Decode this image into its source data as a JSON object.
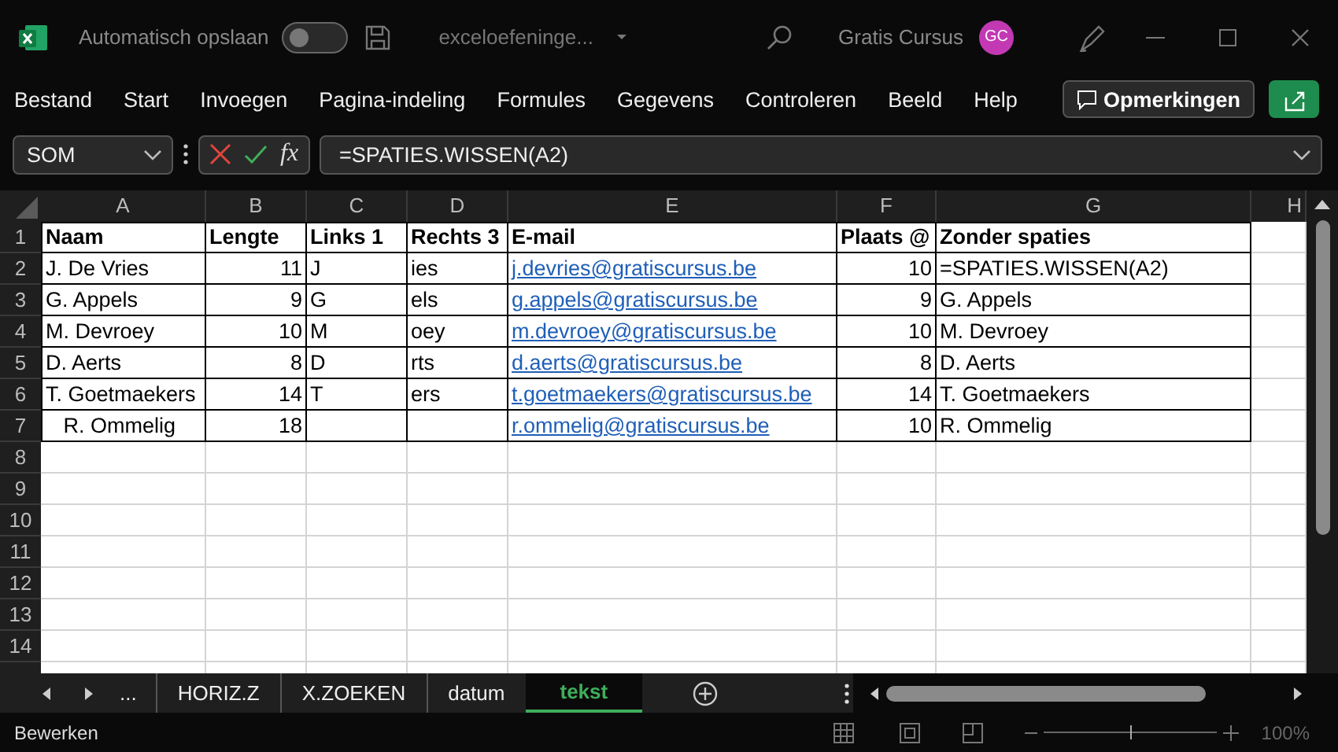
{
  "titlebar": {
    "autosave_label": "Automatisch opslaan",
    "autosave_on": false,
    "filename": "exceloefeninge...",
    "account": "Gratis Cursus",
    "avatar": "GC"
  },
  "ribbon": {
    "tabs": [
      "Bestand",
      "Start",
      "Invoegen",
      "Pagina-indeling",
      "Formules",
      "Gegevens",
      "Controleren",
      "Beeld",
      "Help"
    ],
    "comments_button": "Opmerkingen"
  },
  "formula_bar": {
    "name_box": "SOM",
    "fx": "fx",
    "formula": "=SPATIES.WISSEN(A2)"
  },
  "sheet": {
    "columns": [
      "A",
      "B",
      "C",
      "D",
      "E",
      "F",
      "G",
      "H"
    ],
    "rows": [
      {
        "number": "1",
        "cells": [
          {
            "kind": "header",
            "text": "Naam"
          },
          {
            "kind": "header",
            "text": "Lengte"
          },
          {
            "kind": "header",
            "text": "Links 1"
          },
          {
            "kind": "header",
            "text": "Rechts 3"
          },
          {
            "kind": "header",
            "text": "E-mail"
          },
          {
            "kind": "header",
            "text": "Plaats @"
          },
          {
            "kind": "header",
            "text": "Zonder spaties"
          }
        ]
      },
      {
        "number": "2",
        "cells": [
          {
            "kind": "text",
            "text": "J. De Vries"
          },
          {
            "kind": "number",
            "text": "11"
          },
          {
            "kind": "text",
            "text": "J"
          },
          {
            "kind": "text",
            "text": "ies"
          },
          {
            "kind": "link",
            "text": "j.devries@gratiscursus.be"
          },
          {
            "kind": "number",
            "text": "10"
          },
          {
            "kind": "text",
            "text": "=SPATIES.WISSEN(A2)"
          }
        ]
      },
      {
        "number": "3",
        "cells": [
          {
            "kind": "text",
            "text": "G. Appels"
          },
          {
            "kind": "number",
            "text": "9"
          },
          {
            "kind": "text",
            "text": "G"
          },
          {
            "kind": "text",
            "text": "els"
          },
          {
            "kind": "link",
            "text": "g.appels@gratiscursus.be"
          },
          {
            "kind": "number",
            "text": "9"
          },
          {
            "kind": "text",
            "text": "G. Appels"
          }
        ]
      },
      {
        "number": "4",
        "cells": [
          {
            "kind": "text",
            "text": "M. Devroey"
          },
          {
            "kind": "number",
            "text": "10"
          },
          {
            "kind": "text",
            "text": "M"
          },
          {
            "kind": "text",
            "text": "oey"
          },
          {
            "kind": "link",
            "text": "m.devroey@gratiscursus.be"
          },
          {
            "kind": "number",
            "text": "10"
          },
          {
            "kind": "text",
            "text": "M. Devroey"
          }
        ]
      },
      {
        "number": "5",
        "cells": [
          {
            "kind": "text",
            "text": "D. Aerts"
          },
          {
            "kind": "number",
            "text": "8"
          },
          {
            "kind": "text",
            "text": "D"
          },
          {
            "kind": "text",
            "text": "rts"
          },
          {
            "kind": "link",
            "text": "d.aerts@gratiscursus.be"
          },
          {
            "kind": "number",
            "text": "8"
          },
          {
            "kind": "text",
            "text": "D. Aerts"
          }
        ]
      },
      {
        "number": "6",
        "cells": [
          {
            "kind": "text",
            "text": "T. Goetmaekers"
          },
          {
            "kind": "number",
            "text": "14"
          },
          {
            "kind": "text",
            "text": "T"
          },
          {
            "kind": "text",
            "text": "ers"
          },
          {
            "kind": "link",
            "text": "t.goetmaekers@gratiscursus.be"
          },
          {
            "kind": "number",
            "text": "14"
          },
          {
            "kind": "text",
            "text": "T. Goetmaekers"
          }
        ]
      },
      {
        "number": "7",
        "cells": [
          {
            "kind": "text",
            "text": "   R. Ommelig"
          },
          {
            "kind": "number",
            "text": "18"
          },
          {
            "kind": "text"
          },
          {
            "kind": "text"
          },
          {
            "kind": "link",
            "text": "r.ommelig@gratiscursus.be"
          },
          {
            "kind": "number",
            "text": "10"
          },
          {
            "kind": "text",
            "text": "R. Ommelig"
          }
        ]
      },
      {
        "number": "8"
      },
      {
        "number": "9"
      },
      {
        "number": "10"
      },
      {
        "number": "11"
      },
      {
        "number": "12"
      },
      {
        "number": "13"
      },
      {
        "number": "14"
      }
    ]
  },
  "sheet_tabs": {
    "more": "...",
    "tabs": [
      {
        "label": "HORIZ.Z",
        "selected": false
      },
      {
        "label": "X.ZOEKEN",
        "selected": false
      },
      {
        "label": "datum",
        "selected": false
      },
      {
        "label": "tekst",
        "selected": true
      }
    ]
  },
  "status_bar": {
    "mode": "Bewerken",
    "zoom_slider": {
      "level": 0.5
    },
    "zoom": "100%"
  }
}
